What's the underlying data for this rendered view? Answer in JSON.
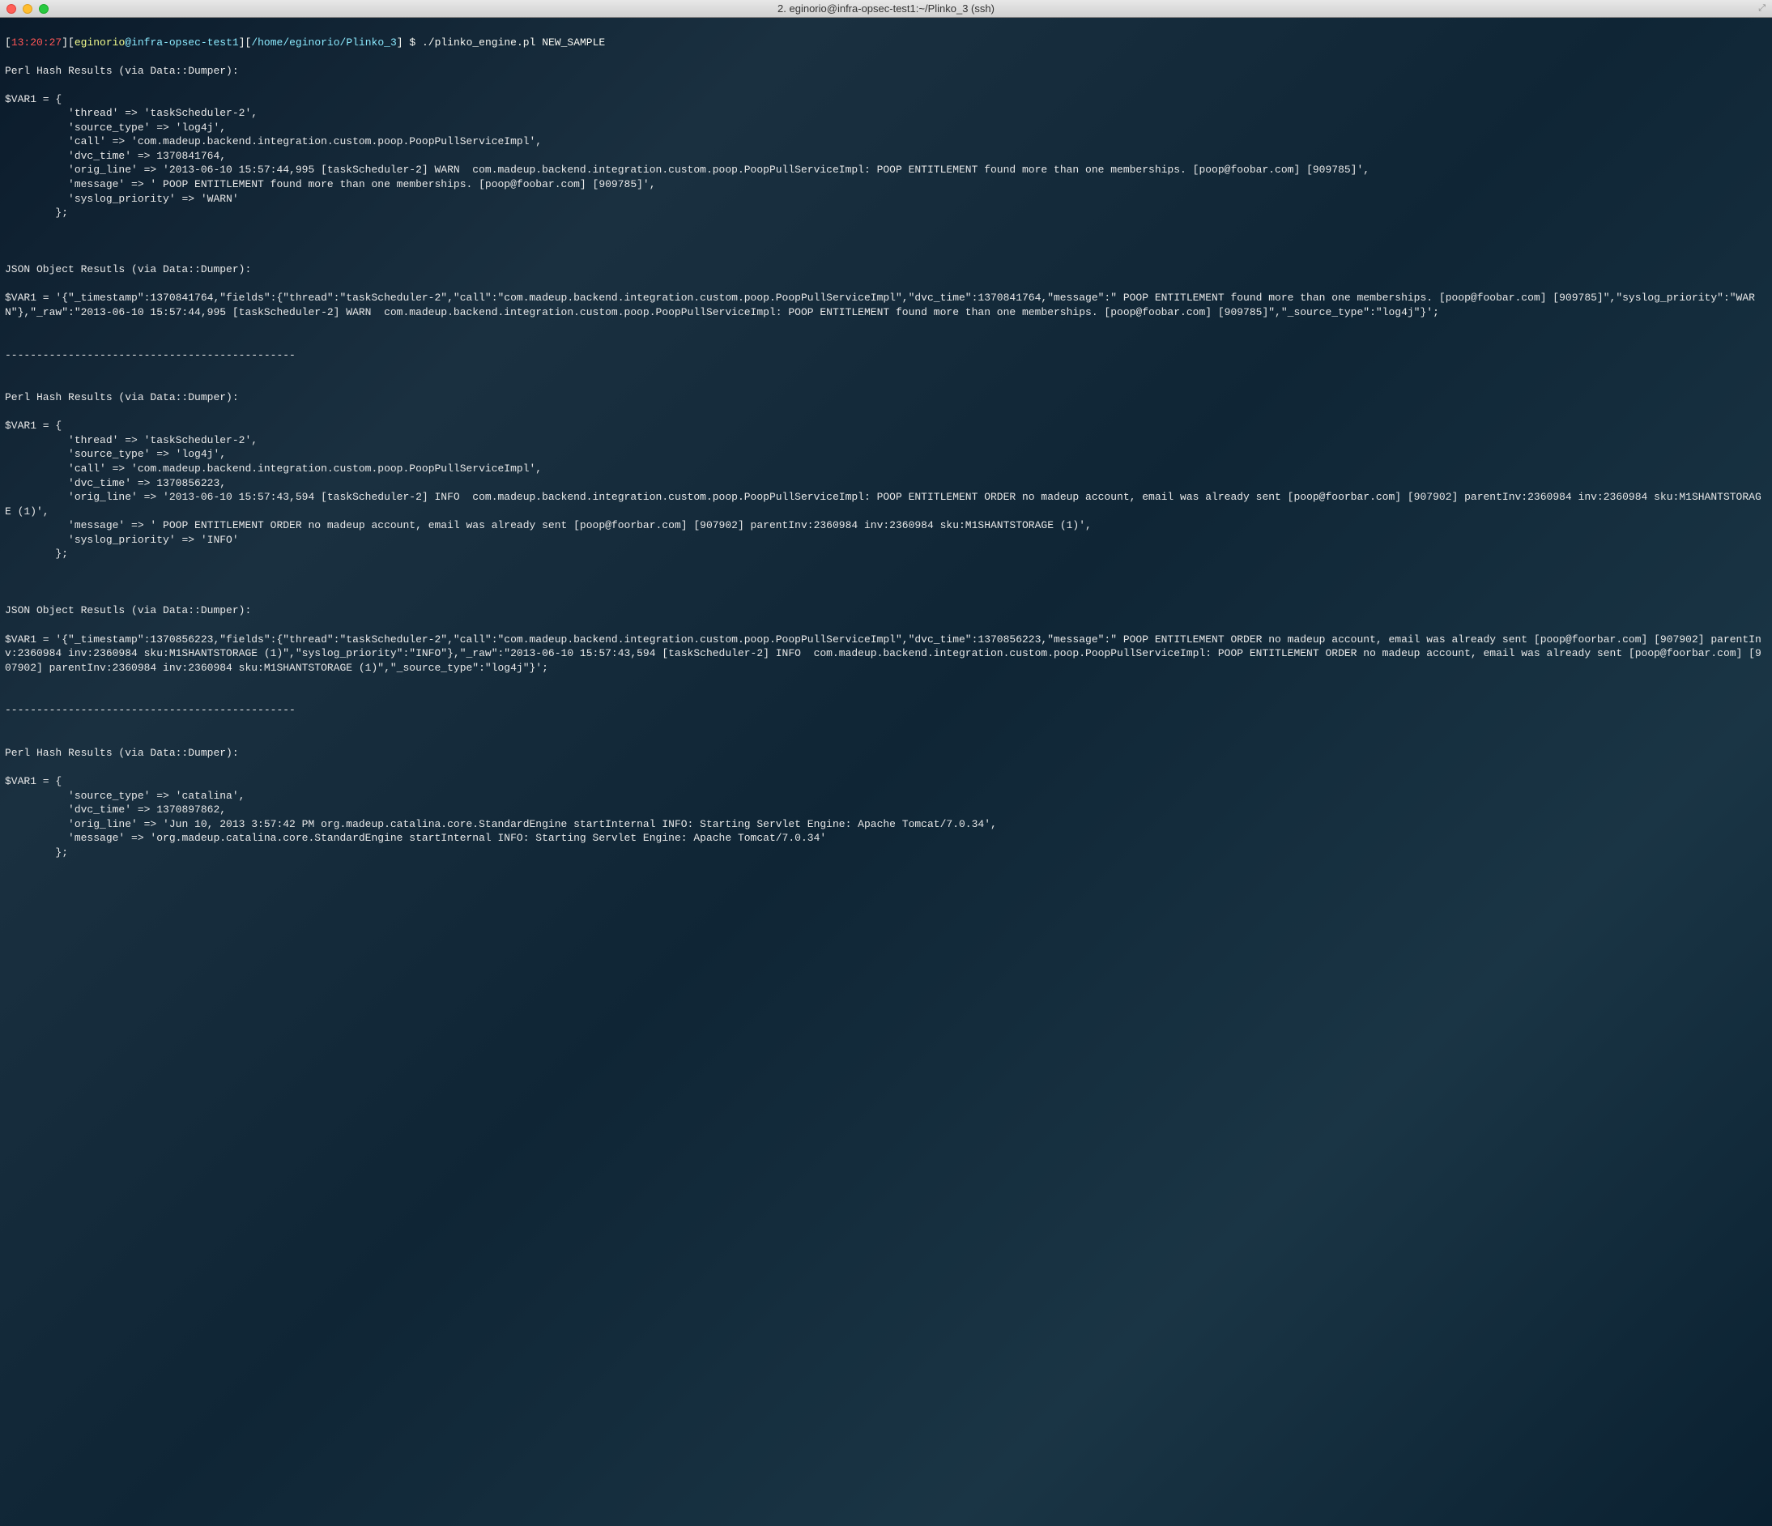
{
  "titlebar": {
    "title": "2. eginorio@infra-opsec-test1:~/Plinko_3 (ssh)"
  },
  "prompt": {
    "open1": "[",
    "time": "13:20:27",
    "close1": "][",
    "user": "eginorio",
    "at": "@",
    "host": "infra-opsec-test1",
    "close2": "][",
    "cwd": "/home/eginorio/Plinko_3",
    "close3": "] $ ",
    "command": "./plinko_engine.pl NEW_SAMPLE"
  },
  "output": {
    "block1_header": "Perl Hash Results (via Data::Dumper):",
    "block1_body": "$VAR1 = {\n          'thread' => 'taskScheduler-2',\n          'source_type' => 'log4j',\n          'call' => 'com.madeup.backend.integration.custom.poop.PoopPullServiceImpl',\n          'dvc_time' => 1370841764,\n          'orig_line' => '2013-06-10 15:57:44,995 [taskScheduler-2] WARN  com.madeup.backend.integration.custom.poop.PoopPullServiceImpl: POOP ENTITLEMENT found more than one memberships. [poop@foobar.com] [909785]',\n          'message' => ' POOP ENTITLEMENT found more than one memberships. [poop@foobar.com] [909785]',\n          'syslog_priority' => 'WARN'\n        };",
    "blank1": "",
    "block2_header": "JSON Object Resutls (via Data::Dumper):",
    "block2_body": "$VAR1 = '{\"_timestamp\":1370841764,\"fields\":{\"thread\":\"taskScheduler-2\",\"call\":\"com.madeup.backend.integration.custom.poop.PoopPullServiceImpl\",\"dvc_time\":1370841764,\"message\":\" POOP ENTITLEMENT found more than one memberships. [poop@foobar.com] [909785]\",\"syslog_priority\":\"WARN\"},\"_raw\":\"2013-06-10 15:57:44,995 [taskScheduler-2] WARN  com.madeup.backend.integration.custom.poop.PoopPullServiceImpl: POOP ENTITLEMENT found more than one memberships. [poop@foobar.com] [909785]\",\"_source_type\":\"log4j\"}';",
    "sep1": "----------------------------------------------",
    "block3_header": "Perl Hash Results (via Data::Dumper):",
    "block3_body": "$VAR1 = {\n          'thread' => 'taskScheduler-2',\n          'source_type' => 'log4j',\n          'call' => 'com.madeup.backend.integration.custom.poop.PoopPullServiceImpl',\n          'dvc_time' => 1370856223,\n          'orig_line' => '2013-06-10 15:57:43,594 [taskScheduler-2] INFO  com.madeup.backend.integration.custom.poop.PoopPullServiceImpl: POOP ENTITLEMENT ORDER no madeup account, email was already sent [poop@foorbar.com] [907902] parentInv:2360984 inv:2360984 sku:M1SHANTSTORAGE (1)',\n          'message' => ' POOP ENTITLEMENT ORDER no madeup account, email was already sent [poop@foorbar.com] [907902] parentInv:2360984 inv:2360984 sku:M1SHANTSTORAGE (1)',\n          'syslog_priority' => 'INFO'\n        };",
    "blank2": "",
    "block4_header": "JSON Object Resutls (via Data::Dumper):",
    "block4_body": "$VAR1 = '{\"_timestamp\":1370856223,\"fields\":{\"thread\":\"taskScheduler-2\",\"call\":\"com.madeup.backend.integration.custom.poop.PoopPullServiceImpl\",\"dvc_time\":1370856223,\"message\":\" POOP ENTITLEMENT ORDER no madeup account, email was already sent [poop@foorbar.com] [907902] parentInv:2360984 inv:2360984 sku:M1SHANTSTORAGE (1)\",\"syslog_priority\":\"INFO\"},\"_raw\":\"2013-06-10 15:57:43,594 [taskScheduler-2] INFO  com.madeup.backend.integration.custom.poop.PoopPullServiceImpl: POOP ENTITLEMENT ORDER no madeup account, email was already sent [poop@foorbar.com] [907902] parentInv:2360984 inv:2360984 sku:M1SHANTSTORAGE (1)\",\"_source_type\":\"log4j\"}';",
    "sep2": "----------------------------------------------",
    "block5_header": "Perl Hash Results (via Data::Dumper):",
    "block5_body": "$VAR1 = {\n          'source_type' => 'catalina',\n          'dvc_time' => 1370897862,\n          'orig_line' => 'Jun 10, 2013 3:57:42 PM org.madeup.catalina.core.StandardEngine startInternal INFO: Starting Servlet Engine: Apache Tomcat/7.0.34',\n          'message' => 'org.madeup.catalina.core.StandardEngine startInternal INFO: Starting Servlet Engine: Apache Tomcat/7.0.34'\n        };"
  }
}
